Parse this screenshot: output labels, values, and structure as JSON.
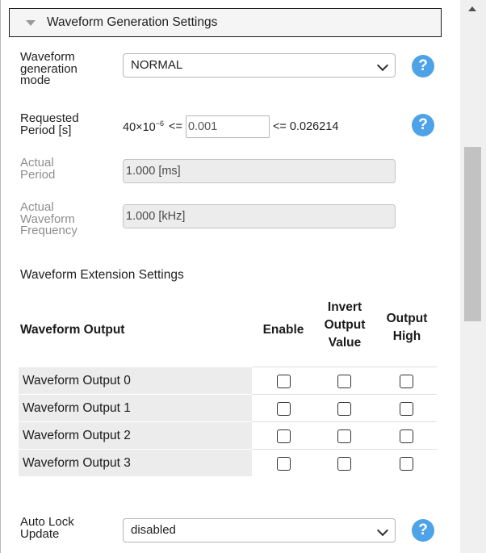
{
  "section": {
    "title": "Waveform Generation Settings"
  },
  "mode": {
    "label_lines": [
      "Waveform",
      "generation",
      "mode"
    ],
    "value": "NORMAL"
  },
  "period": {
    "label_lines": [
      "Requested",
      "Period [s]"
    ],
    "min_prefix": "40×10",
    "min_exp": "−6",
    "op1": "<=",
    "value": "0.001",
    "max_text": "<= 0.026214"
  },
  "actual_period": {
    "label_lines": [
      "Actual",
      "Period"
    ],
    "value": "1.000 [ms]"
  },
  "actual_freq": {
    "label_lines": [
      "Actual",
      "Waveform",
      "Frequency"
    ],
    "value": "1.000 [kHz]"
  },
  "extension": {
    "title": "Waveform Extension Settings",
    "headers": {
      "output": "Waveform Output",
      "enable": "Enable",
      "invert_lines": [
        "Invert",
        "Output",
        "Value"
      ],
      "high_lines": [
        "Output",
        "High"
      ]
    },
    "rows": [
      {
        "name": "Waveform Output 0",
        "enable": false,
        "invert": false,
        "high": false
      },
      {
        "name": "Waveform Output 1",
        "enable": false,
        "invert": false,
        "high": false
      },
      {
        "name": "Waveform Output 2",
        "enable": false,
        "invert": false,
        "high": false
      },
      {
        "name": "Waveform Output 3",
        "enable": false,
        "invert": false,
        "high": false
      }
    ]
  },
  "auto_lock": {
    "label_lines": [
      "Auto Lock",
      "Update"
    ],
    "value": "disabled"
  },
  "help_glyph": "?",
  "colors": {
    "help": "#4ea3e8",
    "disabled_text": "#8e8e8e",
    "row_bg": "#ececec"
  }
}
